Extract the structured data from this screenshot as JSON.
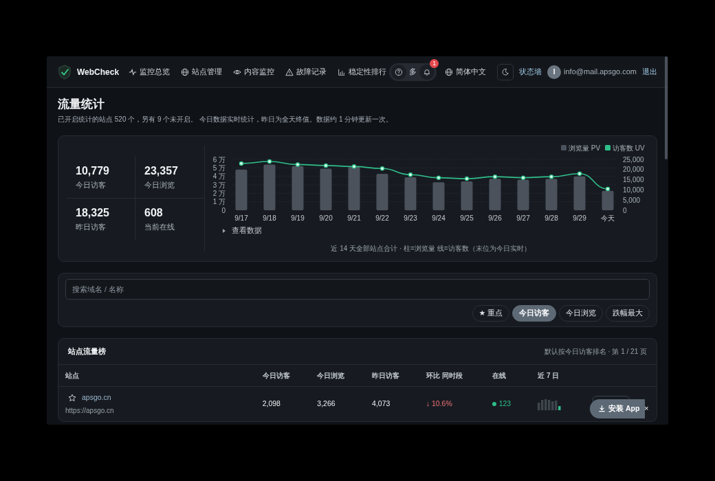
{
  "brand": "WebCheck",
  "nav": [
    {
      "label": "监控总览"
    },
    {
      "label": "站点管理"
    },
    {
      "label": "内容监控"
    },
    {
      "label": "故障记录"
    },
    {
      "label": "稳定性排行"
    }
  ],
  "more": {
    "label": "多",
    "badge": "1"
  },
  "language": "简体中文",
  "status_wall": "状态墙",
  "user": {
    "avatar": "I",
    "email": "info@mail.apsgo.com",
    "logout": "退出"
  },
  "page": {
    "title": "流量统计",
    "subtitle": "已开启统计的站点 520 个，另有 9 个未开启。 今日数据实时统计，昨日为全天终值。数据约 1 分钟更新一次。"
  },
  "stats": [
    {
      "value": "10,779",
      "label": "今日访客"
    },
    {
      "value": "23,357",
      "label": "今日浏览"
    },
    {
      "value": "18,325",
      "label": "昨日访客"
    },
    {
      "value": "608",
      "label": "当前在线"
    }
  ],
  "chart": {
    "pv_chart": {
      "chart_data": {
        "type": "bar",
        "categories": [
          "9/17",
          "9/18",
          "9/19",
          "9/20",
          "9/21",
          "9/22",
          "9/23",
          "9/24",
          "9/25",
          "9/26",
          "9/27",
          "9/28",
          "9/29",
          "今天"
        ],
        "series": [
          {
            "name": "浏览量 PV",
            "color": "#4b525c",
            "values": [
              4.8,
              5.4,
              5.2,
              4.9,
              5.2,
              4.3,
              3.9,
              3.3,
              3.4,
              3.7,
              3.6,
              3.7,
              4.0,
              2.3
            ]
          }
        ],
        "ylim": [
          0,
          6
        ],
        "yticks": [
          0,
          {
            "value": 1,
            "label": "1 万"
          },
          {
            "value": 2,
            "label": "2 万"
          },
          {
            "value": 3,
            "label": "3 万"
          },
          {
            "value": 4,
            "label": "4 万"
          },
          {
            "value": 5,
            "label": "5 万"
          },
          {
            "value": 6,
            "label": "6 万"
          }
        ],
        "grid": true,
        "legend": "top-right"
      }
    },
    "uv_chart": {
      "chart_data": {
        "type": "line",
        "series": [
          {
            "name": "访客数 UV",
            "color": "#2fbf8a",
            "marker": "circle",
            "values": [
              23000,
              24000,
              22500,
              22000,
              21500,
              20500,
              17500,
              16000,
              15500,
              16500,
              16000,
              16500,
              18000,
              10500
            ]
          }
        ],
        "ylim": [
          0,
          25000
        ],
        "yticks": [
          0,
          {
            "value": 5000,
            "label": "5,000"
          },
          {
            "value": 10000,
            "label": "10,000"
          },
          {
            "value": 15000,
            "label": "15,000"
          },
          {
            "value": 20000,
            "label": "20,000"
          },
          {
            "value": 25000,
            "label": "25,000"
          }
        ],
        "legend": "top-right"
      }
    },
    "toggle": "查看数据",
    "caption": "近 14 天全部站点合计 · 柱=浏览量 线=访客数（末位为今日实时）"
  },
  "search": {
    "placeholder": "搜索域名 / 名称"
  },
  "filters": [
    {
      "label": "★ 重点",
      "selected": false
    },
    {
      "label": "今日访客",
      "selected": true
    },
    {
      "label": "今日浏览",
      "selected": false
    },
    {
      "label": "跌幅最大",
      "selected": false
    }
  ],
  "table": {
    "title": "站点流量榜",
    "note": "默认按今日访客排名 · 第 1 / 21 页",
    "columns": [
      "站点",
      "今日访客",
      "今日浏览",
      "昨日访客",
      "环比 同时段",
      "在线",
      "近 7 日"
    ],
    "rows": [
      {
        "name": "apsgo.cn",
        "url": "https://apsgo.cn",
        "starred": false,
        "today_visitors": "2,098",
        "today_views": "3,266",
        "yesterday_visitors": "4,073",
        "change": "↓ 10.6%",
        "falling": true,
        "online": "123"
      }
    ]
  },
  "install": {
    "label": "安装 App",
    "close": "×"
  }
}
